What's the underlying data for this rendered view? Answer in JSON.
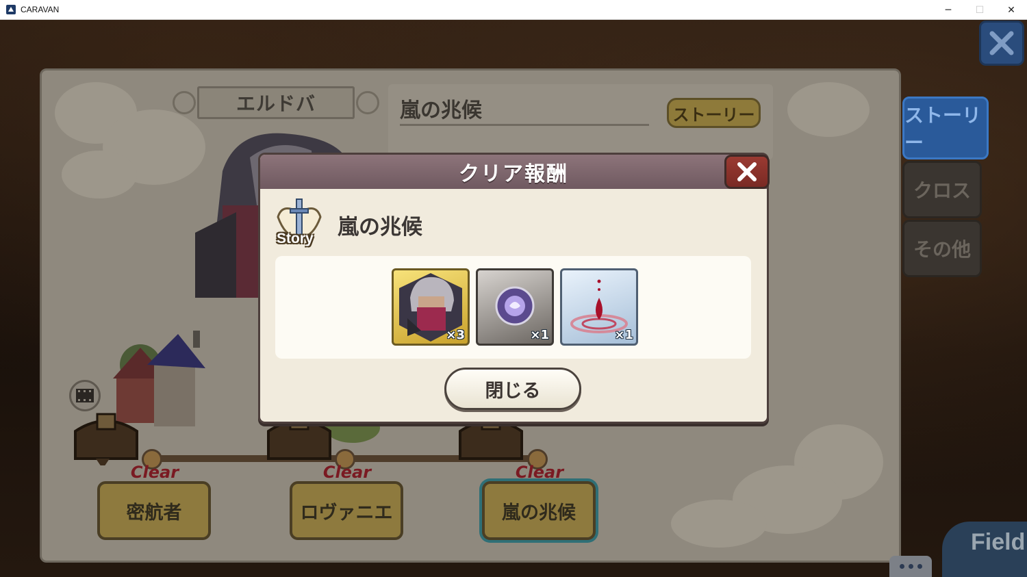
{
  "window": {
    "title": "CARAVAN",
    "controls": {
      "minimize": "─",
      "maximize": "☐",
      "close": "✕"
    }
  },
  "panel": {
    "chapter_name": "エルドバ",
    "stage_title": "嵐の兆候",
    "story_button": "ストーリー"
  },
  "side_tabs": [
    {
      "label": "ストーリー",
      "active": true
    },
    {
      "label": "クロス",
      "active": false
    },
    {
      "label": "その他",
      "active": false
    }
  ],
  "stages": [
    {
      "name": "密航者",
      "status": "Clear"
    },
    {
      "name": "ロヴァニエ",
      "status": "Clear"
    },
    {
      "name": "嵐の兆候",
      "status": "Clear",
      "current": true
    }
  ],
  "modal": {
    "title": "クリア報酬",
    "emblem_label": "Story",
    "stage_name": "嵐の兆候",
    "rewards": [
      {
        "icon": "character-portrait-icon",
        "count": "×3"
      },
      {
        "icon": "purple-orb-icon",
        "count": "×1"
      },
      {
        "icon": "blood-drop-icon",
        "count": "×1"
      }
    ],
    "close_button": "閉じる"
  },
  "bottom": {
    "field_label": "Field"
  },
  "colors": {
    "modal_header": "#7f676d",
    "close_red": "#8a3029",
    "tab_active": "#2a5a9a",
    "clear_text": "#7a1a22"
  }
}
